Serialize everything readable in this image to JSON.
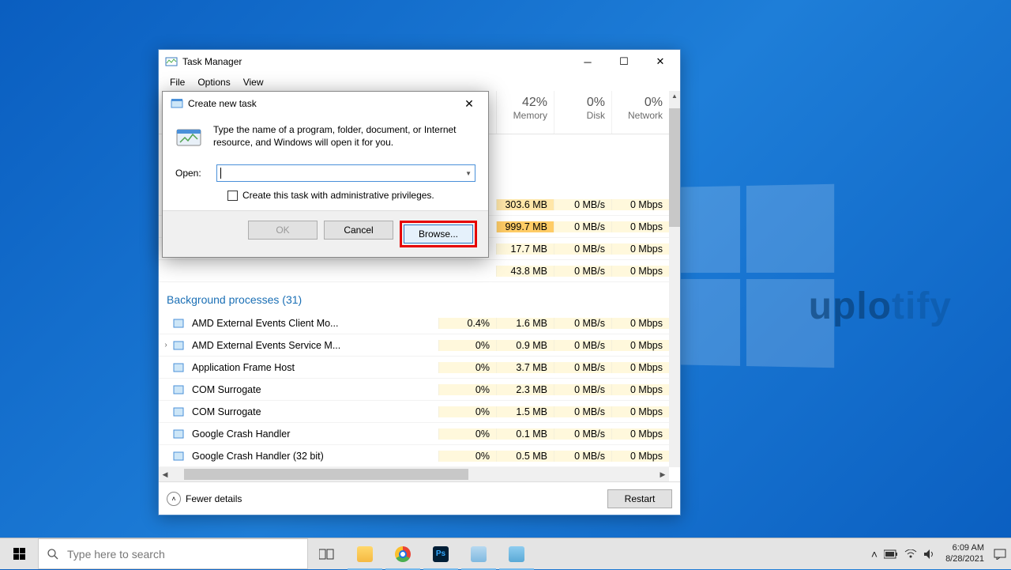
{
  "watermark": {
    "bright": "uplo",
    "dim": "tify"
  },
  "taskManager": {
    "title": "Task Manager",
    "menu": [
      "File",
      "Options",
      "View"
    ],
    "columns": [
      {
        "pct": "42%",
        "label": "Memory"
      },
      {
        "pct": "0%",
        "label": "Disk"
      },
      {
        "pct": "0%",
        "label": "Network"
      }
    ],
    "topRows": [
      {
        "mem": "303.6 MB",
        "disk": "0 MB/s",
        "net": "0 Mbps",
        "memHeat": "heat-med"
      },
      {
        "mem": "999.7 MB",
        "disk": "0 MB/s",
        "net": "0 Mbps",
        "memHeat": "heat-high"
      },
      {
        "mem": "17.7 MB",
        "disk": "0 MB/s",
        "net": "0 Mbps",
        "memHeat": "heat-low"
      },
      {
        "mem": "43.8 MB",
        "disk": "0 MB/s",
        "net": "0 Mbps",
        "memHeat": "heat-low"
      }
    ],
    "sectionTitle": "Background processes (31)",
    "bgRows": [
      {
        "name": "AMD External Events Client Mo...",
        "cpu": "0.4%",
        "mem": "1.6 MB",
        "disk": "0 MB/s",
        "net": "0 Mbps",
        "exp": ""
      },
      {
        "name": "AMD External Events Service M...",
        "cpu": "0%",
        "mem": "0.9 MB",
        "disk": "0 MB/s",
        "net": "0 Mbps",
        "exp": "›"
      },
      {
        "name": "Application Frame Host",
        "cpu": "0%",
        "mem": "3.7 MB",
        "disk": "0 MB/s",
        "net": "0 Mbps",
        "exp": ""
      },
      {
        "name": "COM Surrogate",
        "cpu": "0%",
        "mem": "2.3 MB",
        "disk": "0 MB/s",
        "net": "0 Mbps",
        "exp": ""
      },
      {
        "name": "COM Surrogate",
        "cpu": "0%",
        "mem": "1.5 MB",
        "disk": "0 MB/s",
        "net": "0 Mbps",
        "exp": ""
      },
      {
        "name": "Google Crash Handler",
        "cpu": "0%",
        "mem": "0.1 MB",
        "disk": "0 MB/s",
        "net": "0 Mbps",
        "exp": ""
      },
      {
        "name": "Google Crash Handler (32 bit)",
        "cpu": "0%",
        "mem": "0.5 MB",
        "disk": "0 MB/s",
        "net": "0 Mbps",
        "exp": ""
      }
    ],
    "footer": {
      "fewer": "Fewer details",
      "restart": "Restart"
    }
  },
  "dialog": {
    "title": "Create new task",
    "desc": "Type the name of a program, folder, document, or Internet resource, and Windows will open it for you.",
    "openLabel": "Open:",
    "checkbox": "Create this task with administrative privileges.",
    "buttons": {
      "ok": "OK",
      "cancel": "Cancel",
      "browse": "Browse..."
    }
  },
  "taskbar": {
    "searchPlaceholder": "Type here to search",
    "time": "6:09 AM",
    "date": "8/28/2021"
  }
}
